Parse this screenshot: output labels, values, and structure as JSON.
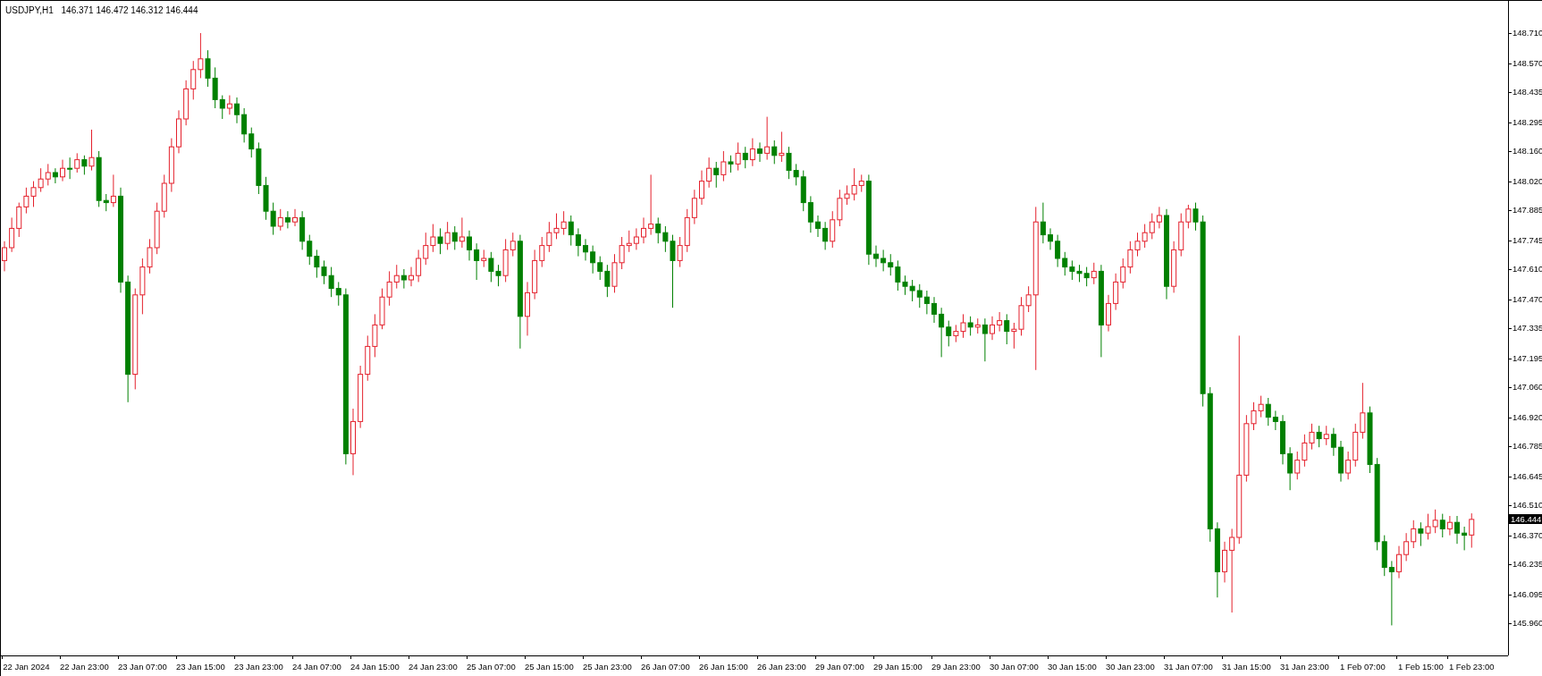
{
  "chart": {
    "symbol": "USDJPY,H1",
    "ohlc_readout": [
      "146.371",
      "146.472",
      "146.312",
      "146.444"
    ],
    "current_price": "146.444",
    "chart_data": {
      "type": "candlestick",
      "categories": [
        null,
        null,
        null,
        "22 Jan 2024",
        null,
        null,
        null,
        null,
        null,
        null,
        null,
        "22 Jan 23:00",
        null,
        null,
        null,
        null,
        null,
        null,
        null,
        "23 Jan 07:00",
        null,
        null,
        null,
        null,
        null,
        null,
        null,
        "23 Jan 15:00",
        null,
        null,
        null,
        null,
        null,
        null,
        null,
        "23 Jan 23:00",
        null,
        null,
        null,
        null,
        null,
        null,
        null,
        "24 Jan 07:00",
        null,
        null,
        null,
        null,
        null,
        null,
        null,
        "24 Jan 15:00",
        null,
        null,
        null,
        null,
        null,
        null,
        null,
        "24 Jan 23:00",
        null,
        null,
        null,
        null,
        null,
        null,
        null,
        "25 Jan 07:00",
        null,
        null,
        null,
        null,
        null,
        null,
        null,
        "25 Jan 15:00",
        null,
        null,
        null,
        null,
        null,
        null,
        null,
        "25 Jan 23:00",
        null,
        null,
        null,
        null,
        null,
        null,
        null,
        "26 Jan 07:00",
        null,
        null,
        null,
        null,
        null,
        null,
        null,
        "26 Jan 15:00",
        null,
        null,
        null,
        null,
        null,
        null,
        null,
        "26 Jan 23:00",
        null,
        null,
        null,
        null,
        null,
        null,
        null,
        "29 Jan 07:00",
        null,
        null,
        null,
        null,
        null,
        null,
        null,
        "29 Jan 15:00",
        null,
        null,
        null,
        null,
        null,
        null,
        null,
        "29 Jan 23:00",
        null,
        null,
        null,
        null,
        null,
        null,
        null,
        "30 Jan 07:00",
        null,
        null,
        null,
        null,
        null,
        null,
        null,
        "30 Jan 15:00",
        null,
        null,
        null,
        null,
        null,
        null,
        null,
        "30 Jan 23:00",
        null,
        null,
        null,
        null,
        null,
        null,
        null,
        "31 Jan 07:00",
        null,
        null,
        null,
        null,
        null,
        null,
        null,
        "31 Jan 15:00",
        null,
        null,
        null,
        null,
        null,
        null,
        null,
        "31 Jan 23:00",
        null,
        null,
        null,
        null,
        null,
        null,
        null,
        "1 Feb 07:00",
        null,
        null,
        null,
        null,
        null,
        null,
        null,
        "1 Feb 15:00",
        null,
        null,
        null,
        null,
        null,
        null,
        "1 Feb 23:00"
      ],
      "ohlc": [
        [
          147.65,
          147.74,
          147.6,
          147.71
        ],
        [
          147.71,
          147.85,
          147.69,
          147.8
        ],
        [
          147.8,
          147.92,
          147.76,
          147.9
        ],
        [
          147.9,
          147.99,
          147.87,
          147.95
        ],
        [
          147.95,
          148.02,
          147.9,
          147.99
        ],
        [
          147.99,
          148.08,
          147.97,
          148.03
        ],
        [
          148.03,
          148.1,
          148.0,
          148.06
        ],
        [
          148.06,
          148.08,
          148.01,
          148.04
        ],
        [
          148.04,
          148.12,
          148.02,
          148.08
        ],
        [
          148.08,
          148.13,
          148.03,
          148.08
        ],
        [
          148.08,
          148.15,
          148.06,
          148.12
        ],
        [
          148.12,
          148.14,
          148.05,
          148.09
        ],
        [
          148.09,
          148.26,
          148.07,
          148.13
        ],
        [
          148.13,
          148.16,
          147.9,
          147.93
        ],
        [
          147.93,
          147.96,
          147.88,
          147.92
        ],
        [
          147.92,
          148.05,
          147.9,
          147.95
        ],
        [
          147.95,
          147.99,
          147.5,
          147.55
        ],
        [
          147.55,
          147.58,
          146.99,
          147.12
        ],
        [
          147.12,
          147.52,
          147.05,
          147.49
        ],
        [
          147.49,
          147.66,
          147.4,
          147.62
        ],
        [
          147.62,
          147.75,
          147.59,
          147.71
        ],
        [
          147.71,
          147.92,
          147.68,
          147.88
        ],
        [
          147.88,
          148.05,
          147.85,
          148.01
        ],
        [
          148.01,
          148.22,
          147.97,
          148.18
        ],
        [
          148.18,
          148.35,
          148.15,
          148.31
        ],
        [
          148.31,
          148.49,
          148.28,
          148.45
        ],
        [
          148.45,
          148.58,
          148.4,
          148.54
        ],
        [
          148.54,
          148.71,
          148.5,
          148.59
        ],
        [
          148.59,
          148.63,
          148.46,
          148.5
        ],
        [
          148.5,
          148.55,
          148.36,
          148.4
        ],
        [
          148.4,
          148.42,
          148.31,
          148.36
        ],
        [
          148.36,
          148.42,
          148.33,
          148.38
        ],
        [
          148.38,
          148.41,
          148.29,
          148.33
        ],
        [
          148.33,
          148.36,
          148.2,
          148.24
        ],
        [
          148.24,
          148.27,
          148.13,
          148.17
        ],
        [
          148.17,
          148.2,
          147.96,
          148.0
        ],
        [
          148.0,
          148.04,
          147.84,
          147.88
        ],
        [
          147.88,
          147.92,
          147.77,
          147.81
        ],
        [
          147.81,
          147.89,
          147.79,
          147.85
        ],
        [
          147.85,
          147.88,
          147.8,
          147.83
        ],
        [
          147.83,
          147.89,
          147.81,
          147.85
        ],
        [
          147.85,
          147.88,
          147.7,
          147.74
        ],
        [
          147.74,
          147.77,
          147.63,
          147.67
        ],
        [
          147.67,
          147.7,
          147.57,
          147.62
        ],
        [
          147.62,
          147.65,
          147.54,
          147.58
        ],
        [
          147.58,
          147.62,
          147.48,
          147.52
        ],
        [
          147.52,
          147.55,
          147.44,
          147.49
        ],
        [
          147.49,
          147.52,
          146.7,
          146.75
        ],
        [
          146.75,
          146.96,
          146.65,
          146.9
        ],
        [
          146.9,
          147.16,
          146.87,
          147.12
        ],
        [
          147.12,
          147.3,
          147.09,
          147.25
        ],
        [
          147.25,
          147.4,
          147.2,
          147.35
        ],
        [
          147.35,
          147.52,
          147.33,
          147.48
        ],
        [
          147.48,
          147.6,
          147.44,
          147.55
        ],
        [
          147.55,
          147.63,
          147.52,
          147.58
        ],
        [
          147.58,
          147.61,
          147.52,
          147.56
        ],
        [
          147.56,
          147.62,
          147.53,
          147.58
        ],
        [
          147.58,
          147.7,
          147.55,
          147.66
        ],
        [
          147.66,
          147.78,
          147.63,
          147.72
        ],
        [
          147.72,
          147.82,
          147.69,
          147.76
        ],
        [
          147.76,
          147.8,
          147.68,
          147.73
        ],
        [
          147.73,
          147.83,
          147.7,
          147.78
        ],
        [
          147.78,
          147.81,
          147.7,
          147.74
        ],
        [
          147.74,
          147.85,
          147.71,
          147.76
        ],
        [
          147.76,
          147.79,
          147.65,
          147.7
        ],
        [
          147.7,
          147.73,
          147.56,
          147.65
        ],
        [
          147.65,
          147.7,
          147.62,
          147.66
        ],
        [
          147.66,
          147.69,
          147.55,
          147.6
        ],
        [
          147.6,
          147.63,
          147.53,
          147.58
        ],
        [
          147.58,
          147.75,
          147.55,
          147.7
        ],
        [
          147.7,
          147.78,
          147.67,
          147.74
        ],
        [
          147.74,
          147.77,
          147.24,
          147.39
        ],
        [
          147.39,
          147.55,
          147.3,
          147.5
        ],
        [
          147.5,
          147.7,
          147.47,
          147.65
        ],
        [
          147.65,
          147.76,
          147.62,
          147.72
        ],
        [
          147.72,
          147.83,
          147.69,
          147.78
        ],
        [
          147.78,
          147.87,
          147.75,
          147.8
        ],
        [
          147.8,
          147.88,
          147.77,
          147.83
        ],
        [
          147.83,
          147.86,
          147.72,
          147.77
        ],
        [
          147.77,
          147.8,
          147.67,
          147.72
        ],
        [
          147.72,
          147.75,
          147.65,
          147.69
        ],
        [
          147.69,
          147.72,
          147.59,
          147.64
        ],
        [
          147.64,
          147.67,
          147.56,
          147.6
        ],
        [
          147.6,
          147.63,
          147.48,
          147.53
        ],
        [
          147.53,
          147.68,
          147.5,
          147.64
        ],
        [
          147.64,
          147.76,
          147.61,
          147.72
        ],
        [
          147.72,
          147.79,
          147.69,
          147.73
        ],
        [
          147.73,
          147.8,
          147.7,
          147.76
        ],
        [
          147.76,
          147.85,
          147.73,
          147.8
        ],
        [
          147.8,
          148.05,
          147.77,
          147.82
        ],
        [
          147.82,
          147.85,
          147.73,
          147.78
        ],
        [
          147.78,
          147.81,
          147.69,
          147.74
        ],
        [
          147.74,
          147.77,
          147.43,
          147.65
        ],
        [
          147.65,
          147.76,
          147.62,
          147.72
        ],
        [
          147.72,
          147.89,
          147.69,
          147.85
        ],
        [
          147.85,
          147.98,
          147.82,
          147.94
        ],
        [
          147.94,
          148.07,
          147.91,
          148.02
        ],
        [
          148.02,
          148.13,
          147.99,
          148.08
        ],
        [
          148.08,
          148.11,
          147.99,
          148.05
        ],
        [
          148.05,
          148.16,
          148.02,
          148.11
        ],
        [
          148.11,
          148.14,
          148.06,
          148.1
        ],
        [
          148.1,
          148.2,
          148.07,
          148.15
        ],
        [
          148.15,
          148.18,
          148.08,
          148.12
        ],
        [
          148.12,
          148.22,
          148.09,
          148.17
        ],
        [
          148.17,
          148.2,
          148.11,
          148.15
        ],
        [
          148.15,
          148.32,
          148.12,
          148.18
        ],
        [
          148.18,
          148.21,
          148.1,
          148.14
        ],
        [
          148.14,
          148.25,
          148.11,
          148.15
        ],
        [
          148.15,
          148.18,
          148.03,
          148.07
        ],
        [
          148.07,
          148.1,
          148.0,
          148.04
        ],
        [
          148.04,
          148.07,
          147.88,
          147.92
        ],
        [
          147.92,
          147.95,
          147.78,
          147.83
        ],
        [
          147.83,
          147.86,
          147.76,
          147.8
        ],
        [
          147.8,
          147.83,
          147.7,
          147.74
        ],
        [
          147.74,
          147.88,
          147.71,
          147.84
        ],
        [
          147.84,
          147.98,
          147.81,
          147.94
        ],
        [
          147.94,
          148.0,
          147.91,
          147.96
        ],
        [
          147.96,
          148.08,
          147.93,
          148.0
        ],
        [
          148.0,
          148.05,
          147.97,
          148.02
        ],
        [
          148.02,
          148.05,
          147.63,
          147.68
        ],
        [
          147.68,
          147.72,
          147.62,
          147.66
        ],
        [
          147.66,
          147.7,
          147.6,
          147.64
        ],
        [
          147.64,
          147.68,
          147.58,
          147.62
        ],
        [
          147.62,
          147.65,
          147.51,
          147.55
        ],
        [
          147.55,
          147.58,
          147.49,
          147.53
        ],
        [
          147.53,
          147.56,
          147.46,
          147.51
        ],
        [
          147.51,
          147.54,
          147.43,
          147.48
        ],
        [
          147.48,
          147.51,
          147.4,
          147.45
        ],
        [
          147.45,
          147.48,
          147.36,
          147.4
        ],
        [
          147.4,
          147.43,
          147.2,
          147.34
        ],
        [
          147.34,
          147.37,
          147.25,
          147.3
        ],
        [
          147.3,
          147.35,
          147.27,
          147.32
        ],
        [
          147.32,
          147.4,
          147.29,
          147.36
        ],
        [
          147.36,
          147.39,
          147.3,
          147.34
        ],
        [
          147.34,
          147.38,
          147.31,
          147.35
        ],
        [
          147.35,
          147.38,
          147.18,
          147.31
        ],
        [
          147.31,
          147.39,
          147.28,
          147.35
        ],
        [
          147.35,
          147.41,
          147.32,
          147.37
        ],
        [
          147.37,
          147.4,
          147.26,
          147.32
        ],
        [
          147.32,
          147.36,
          147.24,
          147.33
        ],
        [
          147.33,
          147.48,
          147.3,
          147.44
        ],
        [
          147.44,
          147.53,
          147.41,
          147.49
        ],
        [
          147.49,
          147.9,
          147.14,
          147.83
        ],
        [
          147.83,
          147.92,
          147.73,
          147.77
        ],
        [
          147.77,
          147.8,
          147.7,
          147.74
        ],
        [
          147.74,
          147.77,
          147.62,
          147.66
        ],
        [
          147.66,
          147.69,
          147.58,
          147.62
        ],
        [
          147.62,
          147.65,
          147.56,
          147.6
        ],
        [
          147.6,
          147.63,
          147.55,
          147.59
        ],
        [
          147.59,
          147.62,
          147.53,
          147.57
        ],
        [
          147.57,
          147.64,
          147.54,
          147.6
        ],
        [
          147.6,
          147.63,
          147.2,
          147.35
        ],
        [
          147.35,
          147.49,
          147.32,
          147.45
        ],
        [
          147.45,
          147.59,
          147.42,
          147.55
        ],
        [
          147.55,
          147.66,
          147.52,
          147.62
        ],
        [
          147.62,
          147.74,
          147.59,
          147.7
        ],
        [
          147.7,
          147.78,
          147.67,
          147.74
        ],
        [
          147.74,
          147.82,
          147.71,
          147.78
        ],
        [
          147.78,
          147.87,
          147.75,
          147.83
        ],
        [
          147.83,
          147.9,
          147.8,
          147.86
        ],
        [
          147.86,
          147.89,
          147.47,
          147.53
        ],
        [
          147.53,
          147.74,
          147.5,
          147.7
        ],
        [
          147.7,
          147.87,
          147.67,
          147.83
        ],
        [
          147.83,
          147.91,
          147.8,
          147.89
        ],
        [
          147.89,
          147.92,
          147.79,
          147.83
        ],
        [
          147.83,
          147.86,
          146.97,
          147.03
        ],
        [
          147.03,
          147.06,
          146.34,
          146.4
        ],
        [
          146.4,
          146.43,
          146.08,
          146.2
        ],
        [
          146.2,
          146.34,
          146.15,
          146.3
        ],
        [
          146.3,
          146.4,
          146.01,
          146.36
        ],
        [
          146.36,
          147.3,
          146.33,
          146.65
        ],
        [
          146.65,
          146.93,
          146.62,
          146.89
        ],
        [
          146.89,
          146.99,
          146.86,
          146.95
        ],
        [
          146.95,
          147.02,
          146.92,
          146.98
        ],
        [
          146.98,
          147.01,
          146.88,
          146.92
        ],
        [
          146.92,
          146.95,
          146.86,
          146.9
        ],
        [
          146.9,
          146.93,
          146.7,
          146.75
        ],
        [
          146.75,
          146.78,
          146.58,
          146.66
        ],
        [
          146.66,
          146.76,
          146.63,
          146.72
        ],
        [
          146.72,
          146.84,
          146.69,
          146.8
        ],
        [
          146.8,
          146.89,
          146.77,
          146.85
        ],
        [
          146.85,
          146.88,
          146.78,
          146.82
        ],
        [
          146.82,
          146.88,
          146.79,
          146.84
        ],
        [
          146.84,
          146.87,
          146.74,
          146.78
        ],
        [
          146.78,
          146.81,
          146.62,
          146.66
        ],
        [
          146.66,
          146.76,
          146.63,
          146.72
        ],
        [
          146.72,
          146.89,
          146.69,
          146.85
        ],
        [
          146.85,
          147.08,
          146.82,
          146.94
        ],
        [
          146.94,
          146.97,
          146.66,
          146.7
        ],
        [
          146.7,
          146.73,
          146.3,
          146.34
        ],
        [
          146.34,
          146.37,
          146.18,
          146.22
        ],
        [
          146.22,
          146.25,
          145.95,
          146.2
        ],
        [
          146.2,
          146.32,
          146.17,
          146.28
        ],
        [
          146.28,
          146.38,
          146.25,
          146.34
        ],
        [
          146.34,
          146.44,
          146.31,
          146.4
        ],
        [
          146.4,
          146.43,
          146.32,
          146.38
        ],
        [
          146.38,
          146.47,
          146.35,
          146.41
        ],
        [
          146.41,
          146.49,
          146.38,
          146.44
        ],
        [
          146.44,
          146.47,
          146.36,
          146.4
        ],
        [
          146.4,
          146.46,
          146.37,
          146.43
        ],
        [
          146.43,
          146.46,
          146.33,
          146.38
        ],
        [
          146.38,
          146.41,
          146.3,
          146.37
        ],
        [
          146.371,
          146.472,
          146.312,
          146.444
        ]
      ],
      "ylim": [
        145.81,
        148.86
      ],
      "yticks": [
        {
          "value": 148.71,
          "label": "148.710"
        },
        {
          "value": 148.57,
          "label": "148.570"
        },
        {
          "value": 148.435,
          "label": "148.435"
        },
        {
          "value": 148.295,
          "label": "148.295"
        },
        {
          "value": 148.16,
          "label": "148.160"
        },
        {
          "value": 148.02,
          "label": "148.020"
        },
        {
          "value": 147.885,
          "label": "147.885"
        },
        {
          "value": 147.745,
          "label": "147.745"
        },
        {
          "value": 147.61,
          "label": "147.610"
        },
        {
          "value": 147.47,
          "label": "147.470"
        },
        {
          "value": 147.335,
          "label": "147.335"
        },
        {
          "value": 147.195,
          "label": "147.195"
        },
        {
          "value": 147.06,
          "label": "147.060"
        },
        {
          "value": 146.92,
          "label": "146.920"
        },
        {
          "value": 146.785,
          "label": "146.785"
        },
        {
          "value": 146.645,
          "label": "146.645"
        },
        {
          "value": 146.51,
          "label": "146.510"
        },
        {
          "value": 146.37,
          "label": "146.370"
        },
        {
          "value": 146.235,
          "label": "146.235"
        },
        {
          "value": 146.095,
          "label": "146.095"
        },
        {
          "value": 145.96,
          "label": "145.960"
        }
      ]
    }
  }
}
